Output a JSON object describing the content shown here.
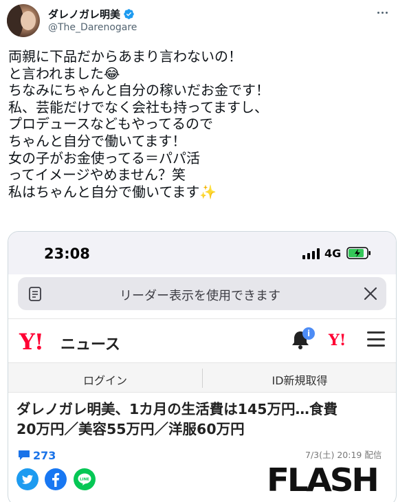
{
  "tweet": {
    "author_name": "ダレノガレ明美",
    "handle": "@The_Darenogare",
    "lines": [
      "両親に下品だからあまり言わないの！",
      "と言われました😂",
      "ちなみにちゃんと自分の稼いだお金です！",
      "私、芸能だけでなく会社も持ってますし、",
      "プロデュースなどもやってるので",
      "ちゃんと自分で働いてます！",
      "女の子がお金使ってる＝パパ活",
      "ってイメージやめません？笑",
      "私はちゃんと自分で働いてます✨"
    ]
  },
  "screenshot": {
    "status_bar": {
      "time": "23:08",
      "network": "4G"
    },
    "reader_bar": {
      "text": "リーダー表示を使用できます"
    },
    "site": {
      "logo": "Y!",
      "name": "ニュース",
      "notification_badge": "i",
      "small_logo": "Y!"
    },
    "auth": {
      "login": "ログイン",
      "signup": "ID新規取得"
    },
    "article": {
      "headline_line1": "ダレノガレ明美、1カ月の生活費は145万円…食費",
      "headline_line2": "20万円／美容55万円／洋服60万円",
      "comment_count": "273",
      "date": "7/3(土) 20:19 配信",
      "publisher": "FLASH"
    }
  },
  "colors": {
    "verified": "#1d9bf0",
    "yahoo_red": "#ff0033",
    "comment_blue": "#1a73e8",
    "battery_green": "#34c759"
  },
  "icons": [
    "verified-icon",
    "more-icon",
    "signal-icon",
    "battery-icon",
    "reader-doc-icon",
    "reader-close-icon",
    "bell-icon",
    "menu-icon",
    "comment-icon",
    "twitter-icon",
    "facebook-icon",
    "line-icon"
  ]
}
